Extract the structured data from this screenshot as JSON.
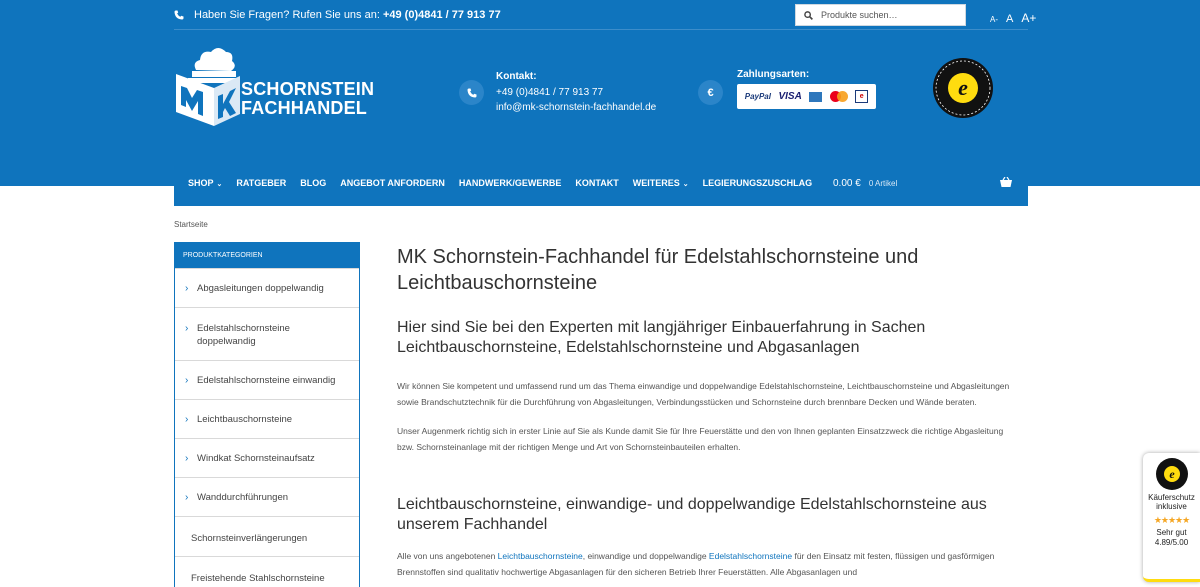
{
  "topbar": {
    "phone_prefix": "Haben Sie Fragen? Rufen Sie uns an:",
    "phone_number": "+49 (0)4841 / 77 913 77",
    "search_placeholder": "Produkte suchen…",
    "font_small": "A-",
    "font_normal": "A",
    "font_large": "A+"
  },
  "brand": {
    "logo_line1": "SCHORNSTEIN",
    "logo_line2": "FACHHANDEL"
  },
  "contact": {
    "heading": "Kontakt:",
    "phone": "+49 (0)4841 / 77 913 77",
    "email": "info@mk-schornstein-fachhandel.de"
  },
  "payment": {
    "heading": "Zahlungsarten:",
    "paypal": "PayPal",
    "visa": "VISA",
    "euro_icon": "€"
  },
  "nav": {
    "items": [
      {
        "label": "SHOP",
        "dropdown": true
      },
      {
        "label": "RATGEBER",
        "dropdown": false
      },
      {
        "label": "BLOG",
        "dropdown": false
      },
      {
        "label": "ANGEBOT ANFORDERN",
        "dropdown": false
      },
      {
        "label": "HANDWERK/GEWERBE",
        "dropdown": false
      },
      {
        "label": "KONTAKT",
        "dropdown": false
      },
      {
        "label": "WEITERES",
        "dropdown": true
      },
      {
        "label": "LEGIERUNGSZUSCHLAG",
        "dropdown": false
      }
    ],
    "cart_total": "0.00 €",
    "cart_count": "0 Artikel"
  },
  "breadcrumb": "Startseite",
  "sidebar": {
    "heading": "PRODUKTKATEGORIEN",
    "items": [
      {
        "label": "Abgasleitungen doppelwandig",
        "chevron": true
      },
      {
        "label": "Edelstahlschornsteine doppelwandig",
        "chevron": true
      },
      {
        "label": "Edelstahlschornsteine einwandig",
        "chevron": true
      },
      {
        "label": "Leichtbauschornsteine",
        "chevron": true
      },
      {
        "label": "Windkat Schornsteinaufsatz",
        "chevron": true
      },
      {
        "label": "Wanddurchführungen",
        "chevron": true
      },
      {
        "label": "Schornsteinverlängerungen",
        "chevron": false
      },
      {
        "label": "Freistehende Stahlschornsteine",
        "chevron": false
      }
    ]
  },
  "content": {
    "title": "MK Schornstein-Fachhandel für Edelstahlschornsteine und Leichtbauschornsteine",
    "subtitle1": "Hier sind Sie bei den Experten mit langjähriger Einbauerfahrung in Sachen Leichtbauschornsteine, Edelstahlschornsteine und Abgasanlagen",
    "para1": "Wir können Sie kompetent und umfassend rund um das Thema einwandige und doppelwandige Edelstahlschornsteine, Leichtbauschornsteine und Abgasleitungen sowie Brandschutztechnik für die Durchführung von Abgasleitungen, Verbindungsstücken und Schornsteine durch brennbare Decken und Wände beraten.",
    "para2": "Unser Augenmerk richtig sich in erster Linie auf Sie als Kunde damit Sie für Ihre Feuerstätte und den von Ihnen geplanten Einsatzzweck die richtige Abgasleitung bzw. Schornsteinanlage mit der richtigen Menge und Art von Schornsteinbauteilen erhalten.",
    "subtitle2": "Leichtbauschornsteine, einwandige- und doppelwandige Edelstahlschornsteine aus unserem Fachhandel",
    "para3_a": "Alle von uns angebotenen ",
    "para3_link1": "Leichtbauschornsteine",
    "para3_b": ", einwandige und doppelwandige ",
    "para3_link2": "Edelstahlschornsteine",
    "para3_c": " für den Einsatz mit festen, flüssigen und gasförmigen Brennstoffen sind qualitativ hochwertige Abgasanlagen für den sicheren Betrieb Ihrer Feuerstätten.  Alle Abgasanlagen und"
  },
  "trust_widget": {
    "line1": "Käuferschutz",
    "line2": "inklusive",
    "stars": "★★★★★",
    "rating_label": "Sehr gut",
    "rating_value": "4.89/5.00"
  },
  "colors": {
    "brand_blue": "#0f74bd",
    "accent_yellow": "#ffdc0f"
  }
}
